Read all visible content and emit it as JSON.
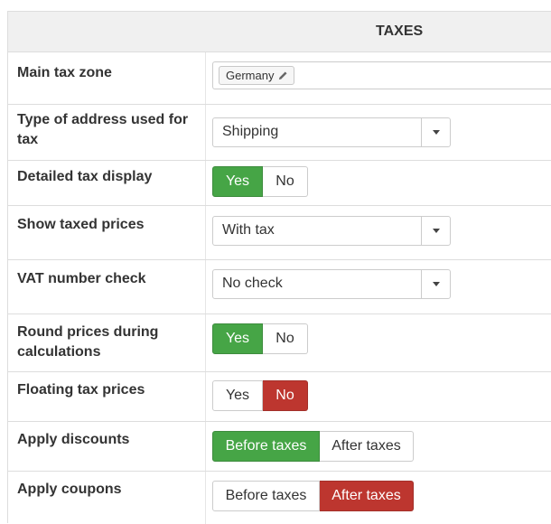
{
  "section_title": "TAXES",
  "main_tax_zone": {
    "label": "Main tax zone",
    "tag": "Germany"
  },
  "address_type": {
    "label": "Type of address used for tax",
    "value": "Shipping"
  },
  "detailed_tax_display": {
    "label": "Detailed tax display",
    "yes": "Yes",
    "no": "No",
    "selected": "Yes"
  },
  "show_taxed_prices": {
    "label": "Show taxed prices",
    "value": "With tax"
  },
  "vat_check": {
    "label": "VAT number check",
    "value": "No check"
  },
  "round_prices": {
    "label": "Round prices during calculations",
    "yes": "Yes",
    "no": "No",
    "selected": "Yes"
  },
  "floating_tax": {
    "label": "Floating tax prices",
    "yes": "Yes",
    "no": "No",
    "selected": "No"
  },
  "apply_discounts": {
    "label": "Apply discounts",
    "before": "Before taxes",
    "after": "After taxes",
    "selected": "Before taxes"
  },
  "apply_coupons": {
    "label": "Apply coupons",
    "before": "Before taxes",
    "after": "After taxes",
    "selected": "After taxes"
  },
  "colors": {
    "green": "#46a546",
    "red": "#bd362f",
    "header_bg": "#f0f0f0",
    "border": "#dddddd"
  },
  "icons": {
    "tag_edit": "pencil-icon",
    "select_open": "caret-down-icon"
  }
}
